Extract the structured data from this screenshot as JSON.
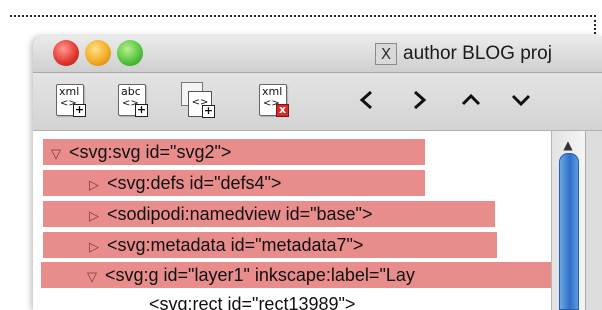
{
  "window": {
    "title": "author BLOG proj",
    "x11_icon_glyph": "X",
    "traffic_lights": {
      "close": "#e0322a",
      "minimize": "#f2a71b",
      "zoom": "#4fc13a"
    }
  },
  "toolbar": {
    "new_element": {
      "line1": "xml",
      "line2": "<>",
      "badge": "+"
    },
    "new_text": {
      "line1": "abc",
      "line2": "<>",
      "badge": "+"
    },
    "duplicate": {
      "line2": "<>",
      "badge": "+"
    },
    "delete": {
      "line1": "xml",
      "line2": "<>",
      "badge": "x"
    },
    "prev": "<",
    "next": ">",
    "up": "^",
    "down": "v"
  },
  "tree": {
    "highlight_color": "#e88c8c",
    "rows": [
      {
        "toggle": "▽",
        "text": "<svg:svg id=\"svg2\">"
      },
      {
        "toggle": "▷",
        "text": "<svg:defs id=\"defs4\">"
      },
      {
        "toggle": "▷",
        "text": "<sodipodi:namedview id=\"base\">"
      },
      {
        "toggle": "▷",
        "text": "<svg:metadata id=\"metadata7\">"
      },
      {
        "toggle": "▽",
        "text": "<svg:g id=\"layer1\" inkscape:label=\"Lay"
      },
      {
        "toggle": "",
        "text": "<svg:rect id=\"rect13989\">"
      }
    ]
  },
  "scrollbar": {
    "up_arrow": "▲"
  }
}
